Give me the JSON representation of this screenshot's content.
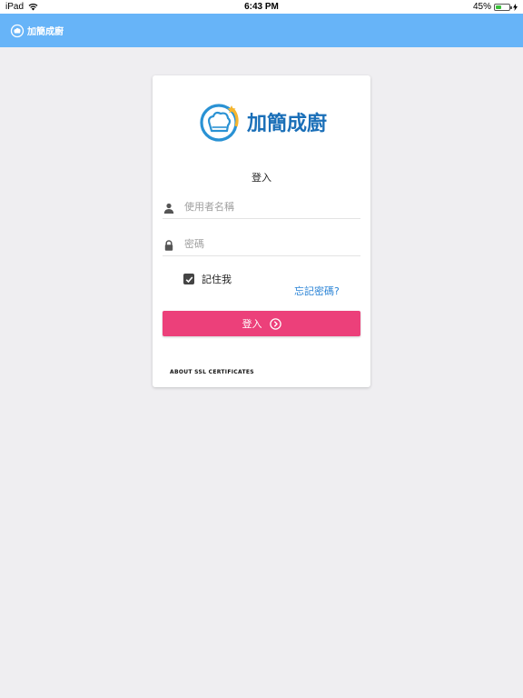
{
  "status_bar": {
    "device": "iPad",
    "time": "6:43 PM",
    "battery": "45%",
    "battery_level": 0.45
  },
  "app_bar": {
    "brand_name": "加簡成廚"
  },
  "card": {
    "logo_text": "加簡成廚",
    "title": "登入",
    "username": {
      "placeholder": "使用者名稱",
      "value": ""
    },
    "password": {
      "placeholder": "密碼",
      "value": ""
    },
    "remember_label": "記住我",
    "remember_checked": true,
    "forgot_label": "忘記密碼?",
    "login_label": "登入",
    "ssl_label": "ABOUT SSL CERTIFICATES"
  },
  "colors": {
    "app_bar": "#67b4f8",
    "login_button": "#ec407a",
    "link": "#2b84d6",
    "logo_text": "#1a6fb8",
    "logo_accent": "#f5b52e"
  }
}
